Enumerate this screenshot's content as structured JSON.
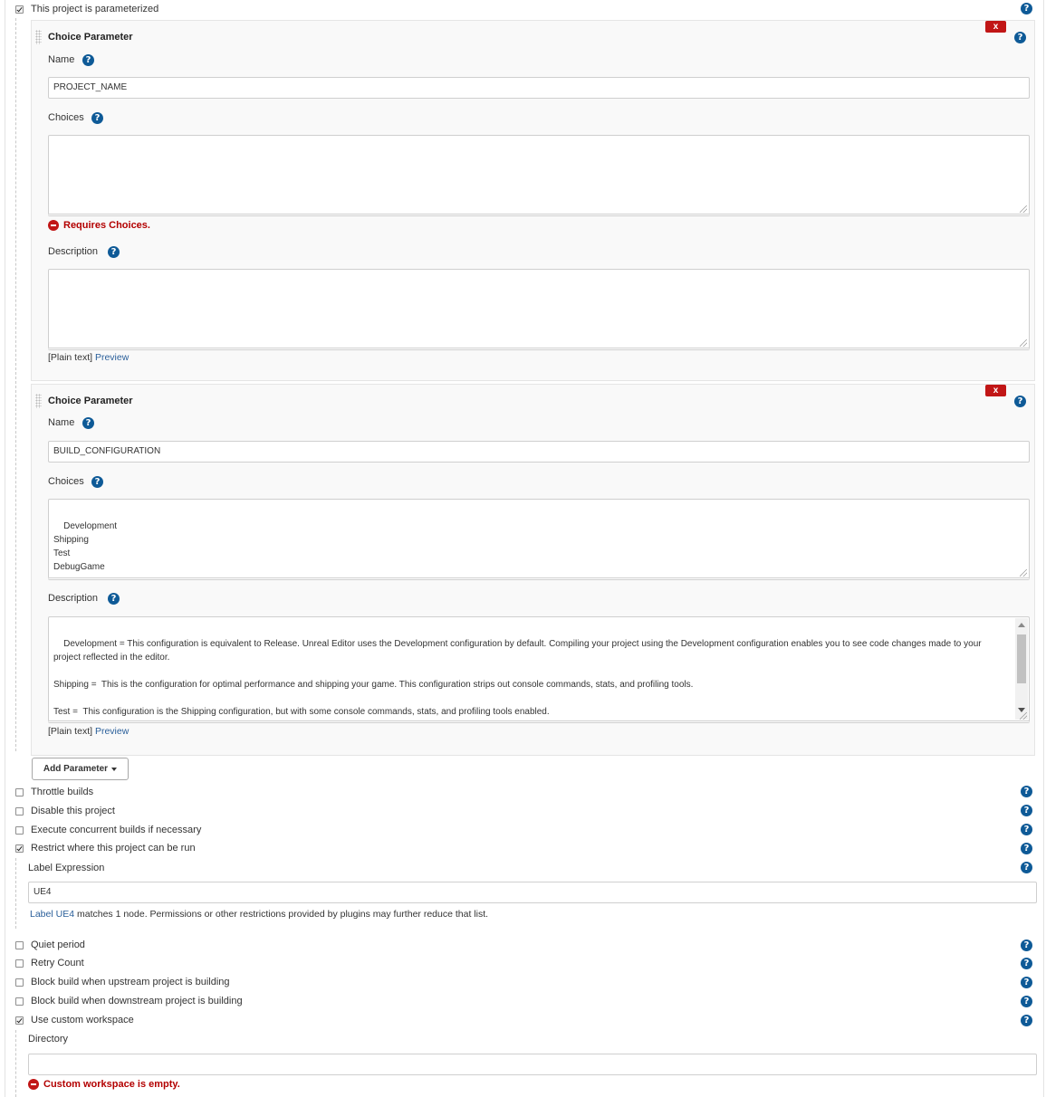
{
  "parameterized": {
    "label": "This project is parameterized",
    "checked": true
  },
  "parameters": [
    {
      "title": "Choice Parameter",
      "delete_label": "x",
      "name_label": "Name",
      "name_value": "PROJECT_NAME",
      "choices_label": "Choices",
      "choices_value": "",
      "choices_error": "Requires Choices.",
      "description_label": "Description",
      "description_value": "",
      "format_text": "[Plain text]",
      "preview_label": "Preview"
    },
    {
      "title": "Choice Parameter",
      "delete_label": "x",
      "name_label": "Name",
      "name_value": "BUILD_CONFIGURATION",
      "choices_label": "Choices",
      "choices_value": "Development\nShipping\nTest\nDebugGame",
      "description_label": "Description",
      "description_value": "Development = This configuration is equivalent to Release. Unreal Editor uses the Development configuration by default. Compiling your project using the Development configuration enables you to see code changes made to your project reflected in the editor.\n\nShipping =  This is the configuration for optimal performance and shipping your game. This configuration strips out console commands, stats, and profiling tools.\n\nTest =  This configuration is the Shipping configuration, but with some console commands, stats, and profiling tools enabled.",
      "format_text": "[Plain text]",
      "preview_label": "Preview"
    }
  ],
  "add_parameter_label": "Add Parameter",
  "options_a": [
    {
      "label": "Throttle builds",
      "checked": false
    },
    {
      "label": "Disable this project",
      "checked": false
    },
    {
      "label": "Execute concurrent builds if necessary",
      "checked": false
    },
    {
      "label": "Restrict where this project can be run",
      "checked": true
    }
  ],
  "restrict": {
    "label_expression_label": "Label Expression",
    "label_expression_value": "UE4",
    "match_label_word": "Label",
    "match_label_link": "UE4",
    "match_rest": " matches 1 node. Permissions or other restrictions provided by plugins may further reduce that list."
  },
  "options_b": [
    {
      "label": "Quiet period",
      "checked": false
    },
    {
      "label": "Retry Count",
      "checked": false
    },
    {
      "label": "Block build when upstream project is building",
      "checked": false
    },
    {
      "label": "Block build when downstream project is building",
      "checked": false
    },
    {
      "label": "Use custom workspace",
      "checked": true
    }
  ],
  "workspace": {
    "directory_label": "Directory",
    "directory_value": "",
    "error": "Custom workspace is empty."
  },
  "help_glyph": "?",
  "icons": {
    "help": "help-icon",
    "error": "error-icon",
    "delete": "delete-icon"
  },
  "colors": {
    "help": "#0e5a97",
    "error": "#b30000",
    "delete": "#c11616",
    "link": "#2a5f9a"
  }
}
